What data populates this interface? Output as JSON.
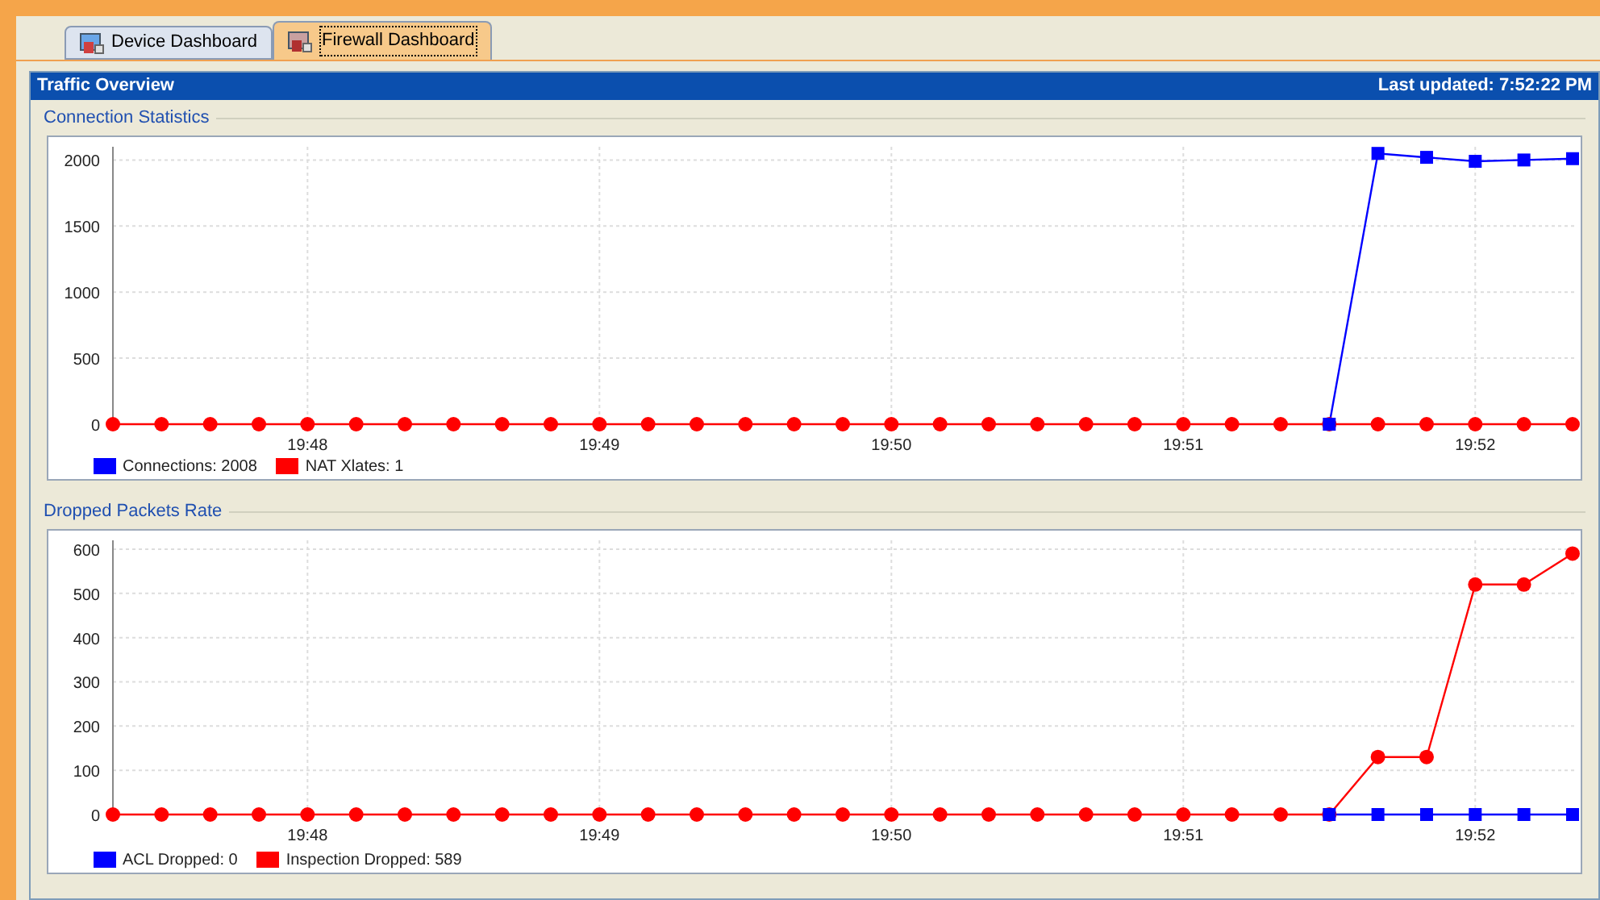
{
  "tabs": [
    {
      "label": "Device Dashboard",
      "selected": false
    },
    {
      "label": "Firewall Dashboard",
      "selected": true
    }
  ],
  "panel": {
    "title": "Traffic Overview",
    "last_updated": "Last updated: 7:52:22 PM"
  },
  "sections": [
    {
      "title": "Connection Statistics",
      "chart_data": {
        "type": "line",
        "categories": [
          null,
          null,
          null,
          null,
          "19:48",
          null,
          null,
          null,
          null,
          null,
          "19:49",
          null,
          null,
          null,
          null,
          null,
          "19:50",
          null,
          null,
          null,
          null,
          null,
          "19:51",
          null,
          null,
          null,
          null,
          null,
          "19:52",
          null,
          null
        ],
        "series": [
          {
            "name": "Connections: 2008",
            "color": "#0000ff",
            "marker": "square",
            "values": [
              null,
              null,
              null,
              null,
              null,
              null,
              null,
              null,
              null,
              null,
              null,
              null,
              null,
              null,
              null,
              null,
              null,
              null,
              null,
              null,
              null,
              null,
              null,
              null,
              null,
              0,
              2050,
              2020,
              1990,
              2000,
              2010
            ]
          },
          {
            "name": "NAT Xlates: 1",
            "color": "#ff0000",
            "marker": "circle",
            "values": [
              0,
              0,
              0,
              0,
              0,
              0,
              0,
              0,
              0,
              0,
              0,
              0,
              0,
              0,
              0,
              0,
              0,
              0,
              0,
              0,
              0,
              0,
              0,
              0,
              0,
              0,
              0,
              0,
              0,
              0,
              0
            ]
          }
        ],
        "ylim": [
          0,
          2100
        ],
        "grid": true,
        "yticks": [
          0,
          500,
          1000,
          1500,
          2000
        ]
      }
    },
    {
      "title": "Dropped Packets Rate",
      "chart_data": {
        "type": "line",
        "categories": [
          null,
          null,
          null,
          null,
          "19:48",
          null,
          null,
          null,
          null,
          null,
          "19:49",
          null,
          null,
          null,
          null,
          null,
          "19:50",
          null,
          null,
          null,
          null,
          null,
          "19:51",
          null,
          null,
          null,
          null,
          null,
          "19:52",
          null,
          null
        ],
        "series": [
          {
            "name": "ACL Dropped: 0",
            "color": "#0000ff",
            "marker": "square",
            "values": [
              null,
              null,
              null,
              null,
              null,
              null,
              null,
              null,
              null,
              null,
              null,
              null,
              null,
              null,
              null,
              null,
              null,
              null,
              null,
              null,
              null,
              null,
              null,
              null,
              null,
              0,
              0,
              0,
              0,
              0,
              0
            ]
          },
          {
            "name": "Inspection Dropped: 589",
            "color": "#ff0000",
            "marker": "circle",
            "values": [
              0,
              0,
              0,
              0,
              0,
              0,
              0,
              0,
              0,
              0,
              0,
              0,
              0,
              0,
              0,
              0,
              0,
              0,
              0,
              0,
              0,
              0,
              0,
              0,
              0,
              0,
              130,
              130,
              520,
              520,
              590
            ]
          }
        ],
        "ylim": [
          0,
          620
        ],
        "grid": true,
        "yticks": [
          0,
          100,
          200,
          300,
          400,
          500,
          600
        ]
      }
    }
  ]
}
